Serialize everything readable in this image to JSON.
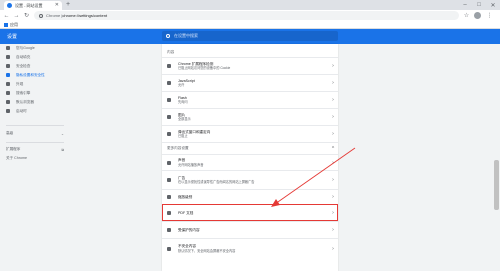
{
  "browser": {
    "tab_title": "设置 - 网站设置",
    "new_tab": "+",
    "win_min": "–",
    "win_max": "□",
    "win_close": "✕",
    "back": "←",
    "forward": "→",
    "reload": "↻",
    "url_prefix": "Chrome | ",
    "url": "chrome://settings/content",
    "star": "☆",
    "menu": "⋮",
    "bookmarks_label": "应用"
  },
  "header": {
    "title": "设置",
    "search_placeholder": "在设置中搜索"
  },
  "sidebar": {
    "items": [
      {
        "label": "您与Google",
        "icon": "person-icon"
      },
      {
        "label": "自动填充",
        "icon": "clipboard-icon"
      },
      {
        "label": "安全检查",
        "icon": "shield-icon"
      },
      {
        "label": "隐私设置和安全性",
        "icon": "shield-lock-icon",
        "active": true
      },
      {
        "label": "外观",
        "icon": "palette-icon"
      },
      {
        "label": "搜索引擎",
        "icon": "search-icon"
      },
      {
        "label": "默认浏览器",
        "icon": "browser-icon"
      },
      {
        "label": "启动时",
        "icon": "power-icon"
      }
    ],
    "advanced": "高级",
    "extensions": "扩展程序",
    "about": "关于 Chrome"
  },
  "content": {
    "section_top": "内容",
    "rows_top": [
      {
        "title": "Chrome 扩展程序检测",
        "subtitle": "已阻止网站访问您的设备中的 Cookie",
        "icon": "cookie-icon"
      },
      {
        "title": "JavaScript",
        "subtitle": "允许",
        "icon": "code-icon"
      },
      {
        "title": "Flash",
        "subtitle": "先询问",
        "icon": "puzzle-icon"
      },
      {
        "title": "图片",
        "subtitle": "全部显示",
        "icon": "image-icon"
      },
      {
        "title": "弹出式窗口和重定向",
        "subtitle": "已阻止",
        "icon": "popup-icon"
      }
    ],
    "section_more": "更多内容设置",
    "rows_more": [
      {
        "title": "声音",
        "subtitle": "允许网站播放声音",
        "icon": "volume-icon"
      },
      {
        "title": "广告",
        "subtitle": "在以显示侵扰性或误导性广告而闻名的网站上屏蔽广告",
        "icon": "ads-icon"
      },
      {
        "title": "缩放级别",
        "subtitle": "",
        "icon": "zoom-icon"
      },
      {
        "title": "PDF 文档",
        "subtitle": "",
        "icon": "pdf-icon"
      },
      {
        "title": "受保护的内容",
        "subtitle": "",
        "icon": "protected-content-icon"
      },
      {
        "title": "不安全内容",
        "subtitle": "默认情况下，安全网站会屏蔽不安全内容",
        "icon": "warning-icon"
      }
    ],
    "chevron": "›",
    "collapse": "^"
  },
  "colors": {
    "accent": "#1a73e8",
    "highlight": "#e53935"
  }
}
